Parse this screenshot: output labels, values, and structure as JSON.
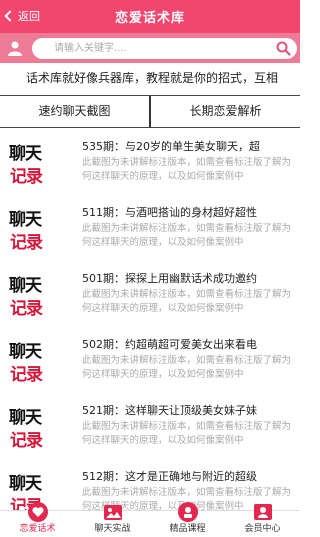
{
  "header": {
    "back_label": "返回",
    "title": "恋爱话术库"
  },
  "search": {
    "placeholder": "请输入关键字...."
  },
  "notice": "话术库就好像兵器库，教程就是你的招式，互相",
  "tabs": [
    {
      "label": "速约聊天截图"
    },
    {
      "label": "长期恋爱解析"
    }
  ],
  "thumb": {
    "line1": "聊天",
    "line2": "记录"
  },
  "items": [
    {
      "title": "535期：与20岁的单生美女聊天，超",
      "desc": "此截图为未讲解标注版本，如需查看标注版了解为何这样聊天的原理，以及如何像案例中"
    },
    {
      "title": "511期：与酒吧搭讪的身材超好超性",
      "desc": "此截图为未讲解标注版本，如需查看标注版了解为何这样聊天的原理，以及如何像案例中"
    },
    {
      "title": "501期：探探上用幽默话术成功邀约",
      "desc": "此截图为未讲解标注版本，如需查看标注版了解为何这样聊天的原理，以及如何像案例中"
    },
    {
      "title": "502期：约超萌超可爱美女出来看电",
      "desc": "此截图为未讲解标注版本，如需查看标注版了解为何这样聊天的原理，以及如何像案例中"
    },
    {
      "title": "521期：这样聊天让顶级美女妹子妹",
      "desc": "此截图为未讲解标注版本，如需查看标注版了解为何这样聊天的原理，以及如何像案例中"
    },
    {
      "title": "512期：这才是正确地与附近的超级",
      "desc": "此截图为未讲解标注版本，如需查看标注版了解为何这样聊天的原理，以及如何像案例中"
    }
  ],
  "tabbar": [
    {
      "label": "恋爱话术",
      "icon": "heart-chat-icon",
      "active": true
    },
    {
      "label": "聊天实战",
      "icon": "image-icon",
      "active": false
    },
    {
      "label": "精品课程",
      "icon": "course-icon",
      "active": false
    },
    {
      "label": "会员中心",
      "icon": "member-icon",
      "active": false
    }
  ],
  "colors": {
    "primary": "#f2466e",
    "search_bar": "#ee7b95",
    "active_label": "#e4274f"
  }
}
